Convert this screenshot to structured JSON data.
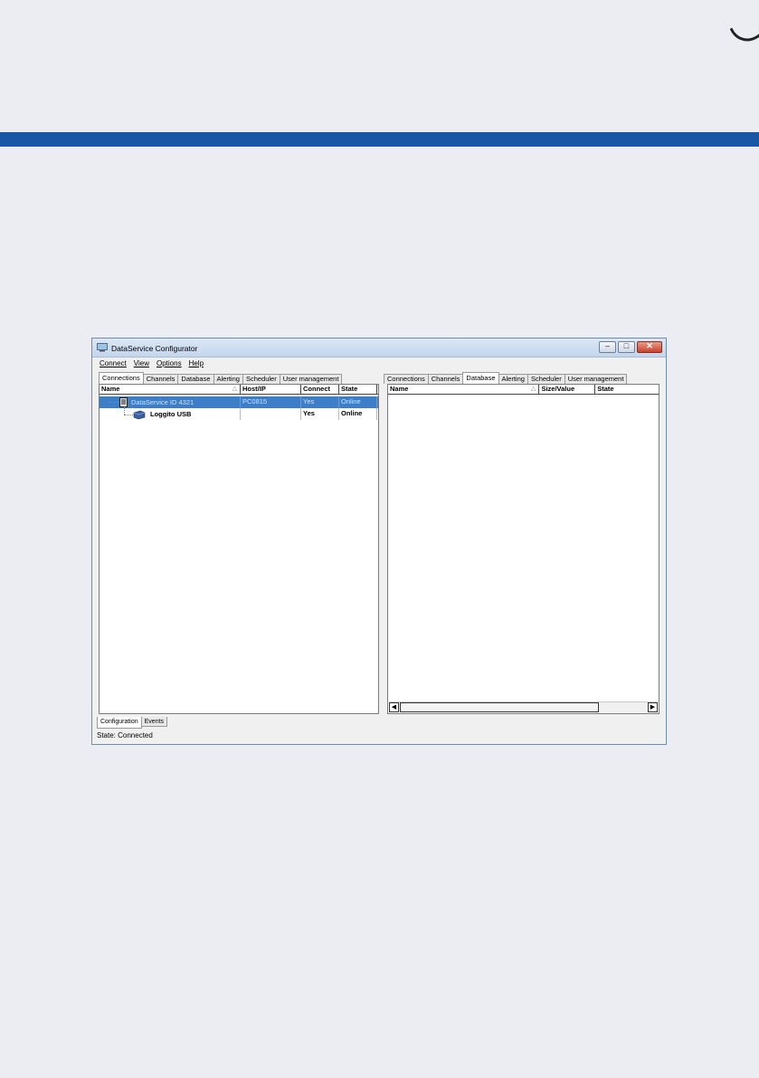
{
  "window": {
    "title": "DataService Configurator"
  },
  "menu": [
    "Connect",
    "View",
    "Options",
    "Help"
  ],
  "left_pane": {
    "tabs": [
      "Connections",
      "Channels",
      "Database",
      "Alerting",
      "Scheduler",
      "User management"
    ],
    "active_tab": "Connections",
    "columns": [
      "Name",
      "Host/IP",
      "Connect",
      "State"
    ],
    "rows": [
      {
        "name": "DataService ID 4321",
        "host": "PC0815",
        "connect": "Yes",
        "state": "Online",
        "selected": true,
        "icon": "server-icon"
      },
      {
        "name": "Loggito USB",
        "host": "",
        "connect": "Yes",
        "state": "Online",
        "selected": false,
        "icon": "usb-device-icon"
      }
    ]
  },
  "right_pane": {
    "tabs": [
      "Connections",
      "Channels",
      "Database",
      "Alerting",
      "Scheduler",
      "User management"
    ],
    "active_tab": "Database",
    "columns": [
      "Name",
      "Size/Value",
      "State"
    ]
  },
  "bottom_tabs": [
    "Configuration",
    "Events"
  ],
  "status": "State: Connected",
  "colors": {
    "brand_band": "#1757a6",
    "selection": "#3d7ec9"
  }
}
